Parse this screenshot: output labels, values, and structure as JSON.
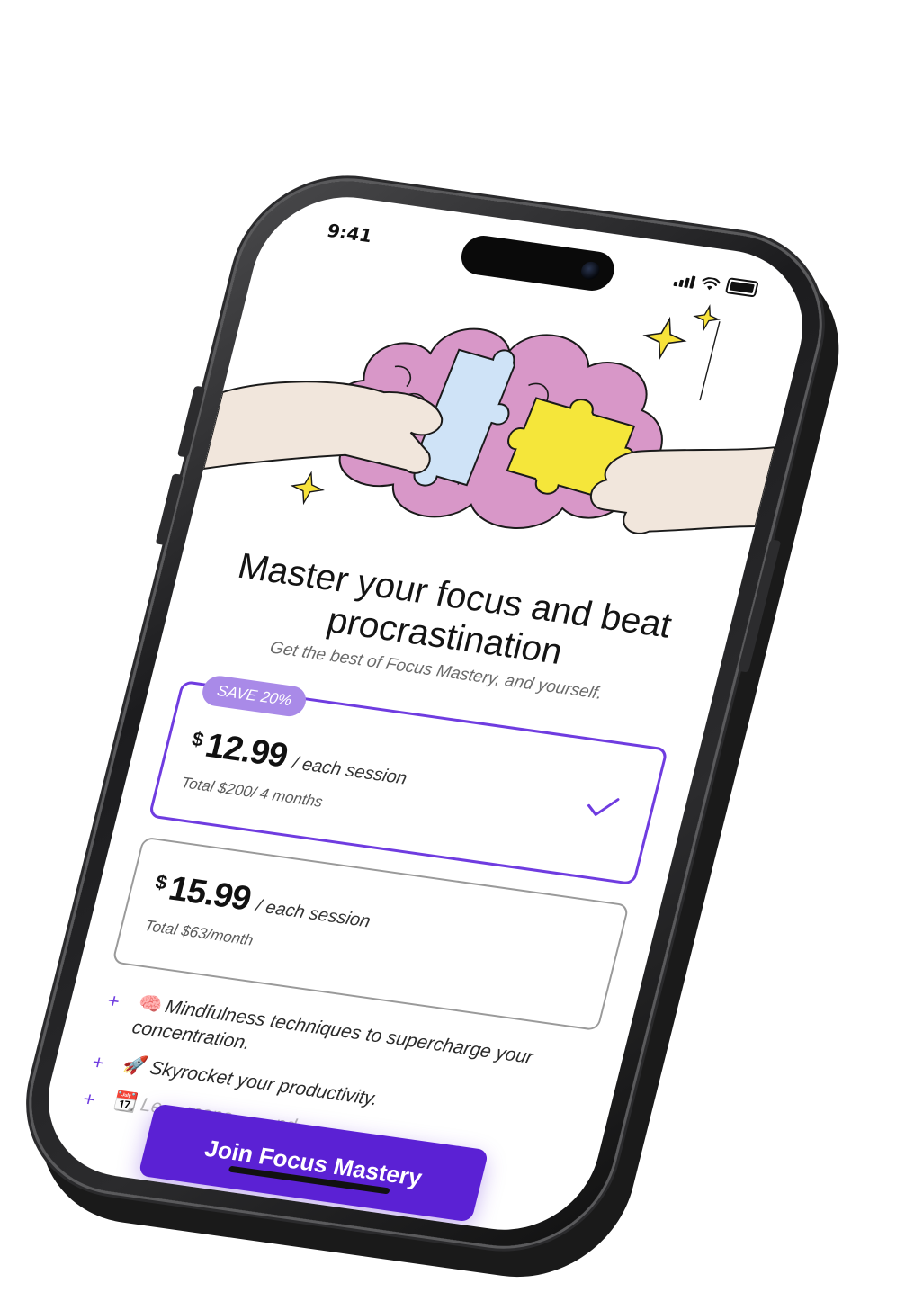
{
  "status_bar": {
    "time": "9:41"
  },
  "header": {
    "title": "Master your focus and beat procrastination",
    "subtitle": "Get the best of Focus Mastery, and yourself."
  },
  "plans": [
    {
      "badge": "SAVE 20%",
      "currency": "$",
      "price": "12.99",
      "period": "/ each session",
      "total": "Total $200/ 4 months",
      "selected": true
    },
    {
      "currency": "$",
      "price": "15.99",
      "period": "/ each session",
      "total": "Total $63/month",
      "selected": false
    }
  ],
  "features": [
    {
      "emoji": "🧠",
      "text": "Mindfulness techniques to supercharge your concentration."
    },
    {
      "emoji": "🚀",
      "text": "Skyrocket your productivity."
    },
    {
      "emoji": "📆",
      "text": "Le… mana… …nd"
    }
  ],
  "cta": {
    "label": "Join Focus Mastery"
  },
  "colors": {
    "accent": "#5b21d4",
    "selected_border": "#6f3ce0",
    "badge": "#a98ae8",
    "hero_cloud": "#d897c8",
    "puzzle_blue": "#cfe3f7",
    "puzzle_yellow": "#f5e63a",
    "sparkle": "#f7e23a"
  },
  "icons": {
    "check": "check-icon",
    "plus": "plus-icon",
    "signal": "cellular-signal-icon",
    "wifi": "wifi-icon",
    "battery": "battery-icon"
  }
}
